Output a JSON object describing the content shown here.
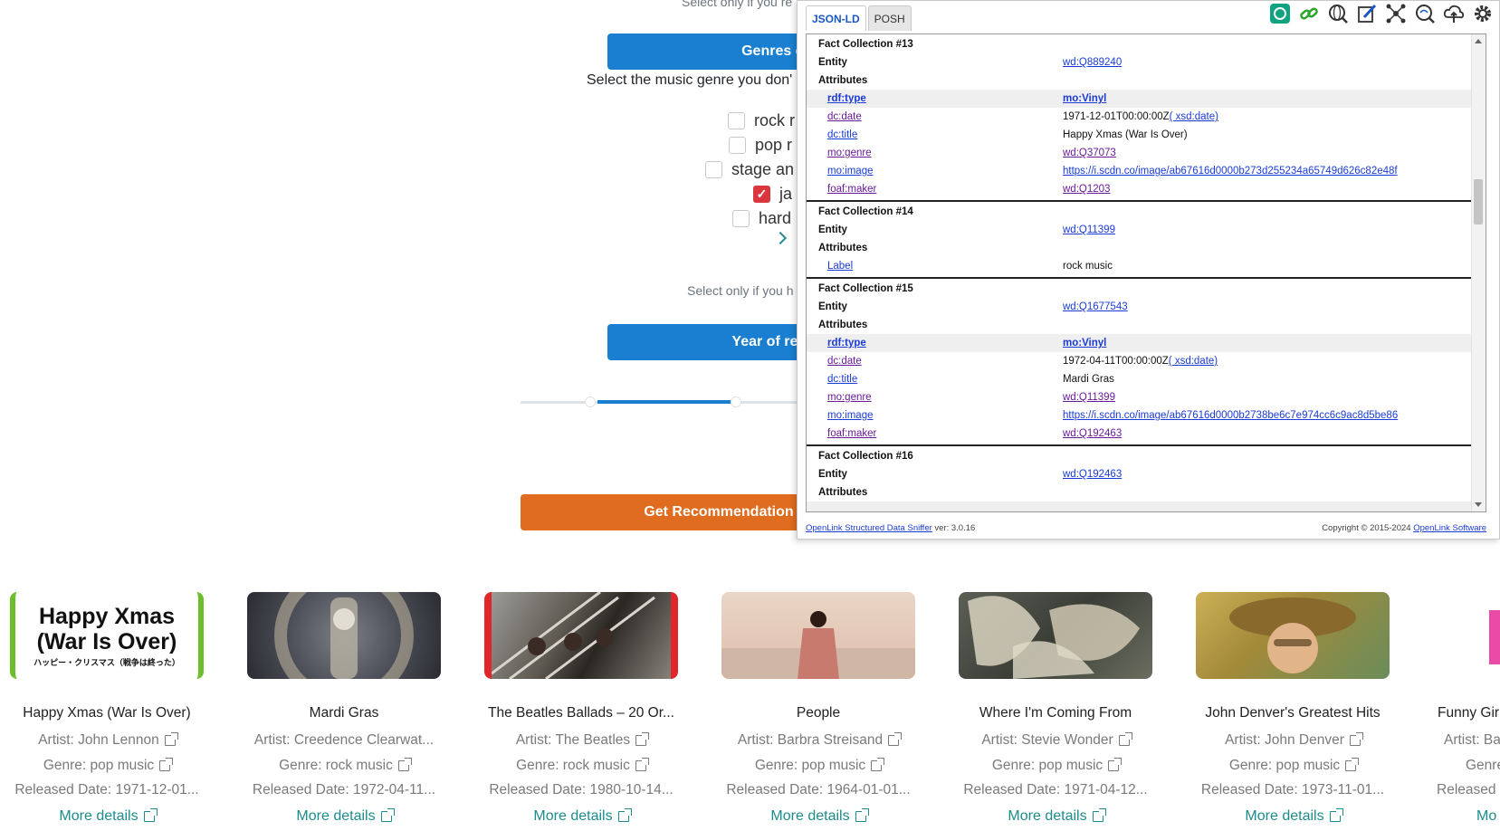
{
  "page": {
    "hint_top": "Select only if you re",
    "genres_button": "Genres di",
    "genres_prompt": "Select the music genre you don'",
    "genres": [
      {
        "label": "rock r",
        "checked": false
      },
      {
        "label": "pop r",
        "checked": false
      },
      {
        "label": "stage an",
        "checked": false
      },
      {
        "label": "ja",
        "checked": true
      },
      {
        "label": "hard",
        "checked": false
      }
    ],
    "hint_year": "Select only if you h",
    "year_button": "Year of relea",
    "recommend_button": "Get Recommendation bas"
  },
  "cards": [
    {
      "title": "Happy Xmas (War Is Over)",
      "artist": "Artist: John Lennon",
      "genre": "Genre: pop music",
      "released": "Released Date: 1971-12-01...",
      "more": "More details",
      "cover_title": "Happy Xmas (War Is Over)",
      "cover_sub": "ハッピー・クリスマス（戦争は終った）"
    },
    {
      "title": "Mardi Gras",
      "artist": "Artist: Creedence Clearwat...",
      "genre": "Genre: rock music",
      "released": "Released Date: 1972-04-11...",
      "more": "More details"
    },
    {
      "title": "The Beatles Ballads – 20 Or...",
      "artist": "Artist: The Beatles",
      "genre": "Genre: rock music",
      "released": "Released Date: 1980-10-14...",
      "more": "More details"
    },
    {
      "title": "People",
      "artist": "Artist: Barbra Streisand",
      "genre": "Genre: pop music",
      "released": "Released Date: 1964-01-01...",
      "more": "More details"
    },
    {
      "title": "Where I'm Coming From",
      "artist": "Artist: Stevie Wonder",
      "genre": "Genre: pop music",
      "released": "Released Date: 1971-04-12...",
      "more": "More details"
    },
    {
      "title": "John Denver's Greatest Hits",
      "artist": "Artist: John Denver",
      "genre": "Genre: pop music",
      "released": "Released Date: 1973-11-01...",
      "more": "More details"
    },
    {
      "title": "Funny Gir",
      "artist": "Artist: Ba",
      "genre": "Genre",
      "released": "Released",
      "more": "Mo"
    }
  ],
  "sniffer": {
    "tabs": [
      "JSON-LD",
      "POSH"
    ],
    "toolbar_icons": [
      "chatgpt-icon",
      "link-icon",
      "globe-search-icon",
      "edit-icon",
      "network-icon",
      "rdf-search-icon",
      "cloud-upload-icon",
      "settings-icon"
    ],
    "facts": [
      {
        "title": "Fact Collection #13",
        "entity_label": "Entity",
        "entity": "wd:Q889240",
        "attributes_label": "Attributes",
        "rows": [
          {
            "k": "rdf:type",
            "v": "mo:Vinyl",
            "bold": true,
            "v_suffix": ""
          },
          {
            "k": "dc:date",
            "v": "1971-12-01T00:00:00Z",
            "plain": true,
            "v_suffix": "( xsd:date)"
          },
          {
            "k": "dc:title",
            "v": "Happy Xmas (War Is Over)",
            "plain": true,
            "v_suffix": ""
          },
          {
            "k": "mo:genre",
            "v": "wd:Q37073",
            "v_suffix": ""
          },
          {
            "k": "mo:image",
            "v": "https://i.scdn.co/image/ab67616d0000b273d255234a65749d626c82e48f",
            "v_suffix": ""
          },
          {
            "k": "foaf:maker",
            "v": "wd:Q1203",
            "v_suffix": ""
          }
        ]
      },
      {
        "title": "Fact Collection #14",
        "entity_label": "Entity",
        "entity": "wd:Q11399",
        "attributes_label": "Attributes",
        "rows": [
          {
            "k": "Label",
            "v": "rock music",
            "plain": true,
            "v_suffix": ""
          }
        ]
      },
      {
        "title": "Fact Collection #15",
        "entity_label": "Entity",
        "entity": "wd:Q1677543",
        "attributes_label": "Attributes",
        "rows": [
          {
            "k": "rdf:type",
            "v": "mo:Vinyl",
            "bold": true,
            "v_suffix": ""
          },
          {
            "k": "dc:date",
            "v": "1972-04-11T00:00:00Z",
            "plain": true,
            "v_suffix": "( xsd:date)"
          },
          {
            "k": "dc:title",
            "v": "Mardi Gras",
            "plain": true,
            "v_suffix": ""
          },
          {
            "k": "mo:genre",
            "v": "wd:Q11399",
            "v_suffix": ""
          },
          {
            "k": "mo:image",
            "v": "https://i.scdn.co/image/ab67616d0000b2738be6c7e974cc6c9ac8d5be86",
            "v_suffix": ""
          },
          {
            "k": "foaf:maker",
            "v": "wd:Q192463",
            "v_suffix": ""
          }
        ]
      },
      {
        "title": "Fact Collection #16",
        "entity_label": "Entity",
        "entity": "wd:Q192463",
        "attributes_label": "Attributes",
        "rows": []
      }
    ],
    "footer_link": "OpenLink Structured Data Sniffer",
    "footer_ver": " ver: 3.0.16",
    "footer_copy": "Copyright © 2015-2024 ",
    "footer_company": "OpenLink Software"
  },
  "colors": {
    "accent_blue": "#1a7fd0",
    "accent_orange": "#e06c1f",
    "teal_link": "#1c8c8c",
    "check_red": "#d9363e"
  }
}
